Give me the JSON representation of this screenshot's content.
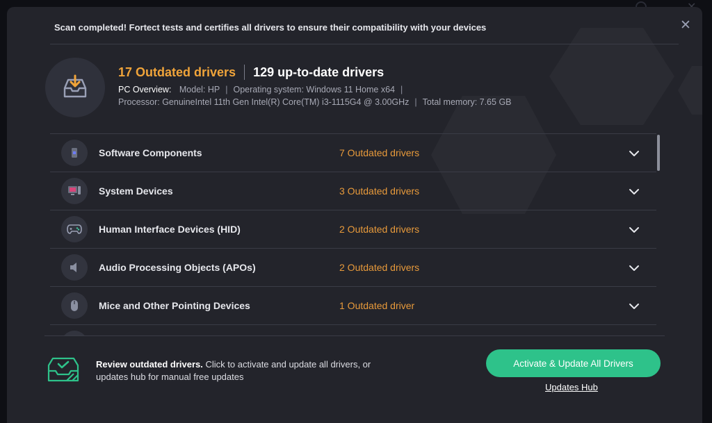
{
  "scan": {
    "message": "Scan completed! Fortect tests and certifies all drivers to ensure their compatibility with your devices",
    "outdated_headline": "17 Outdated drivers",
    "uptodate_headline": "129 up-to-date drivers"
  },
  "pc_overview": {
    "label": "PC Overview:",
    "model": "Model: HP",
    "os": "Operating system: Windows 11 Home x64",
    "processor": "Processor: GenuineIntel 11th Gen Intel(R) Core(TM) i3-1115G4 @ 3.00GHz",
    "memory": "Total memory: 7.65 GB"
  },
  "categories": [
    {
      "name": "Software Components",
      "status": "7 Outdated drivers",
      "icon": "software-components-icon"
    },
    {
      "name": "System Devices",
      "status": "3 Outdated drivers",
      "icon": "system-devices-icon"
    },
    {
      "name": "Human Interface Devices (HID)",
      "status": "2 Outdated drivers",
      "icon": "gamepad-icon"
    },
    {
      "name": "Audio Processing Objects (APOs)",
      "status": "2 Outdated drivers",
      "icon": "speaker-icon"
    },
    {
      "name": "Mice and Other Pointing Devices",
      "status": "1 Outdated driver",
      "icon": "mouse-icon"
    }
  ],
  "footer": {
    "bold_text": "Review outdated drivers.",
    "text": " Click to activate and update all drivers, or updates hub for manual free updates",
    "cta_label": "Activate & Update All Drivers",
    "hub_link": "Updates Hub"
  },
  "colors": {
    "accent_orange": "#f0a43a",
    "cta_green": "#2ec28a",
    "dialog_bg": "#23242b"
  },
  "icons": {
    "close": "close-icon",
    "summary": "download-tray-icon",
    "footer": "review-drivers-icon",
    "row_toggle": "chevron-down-icon"
  }
}
